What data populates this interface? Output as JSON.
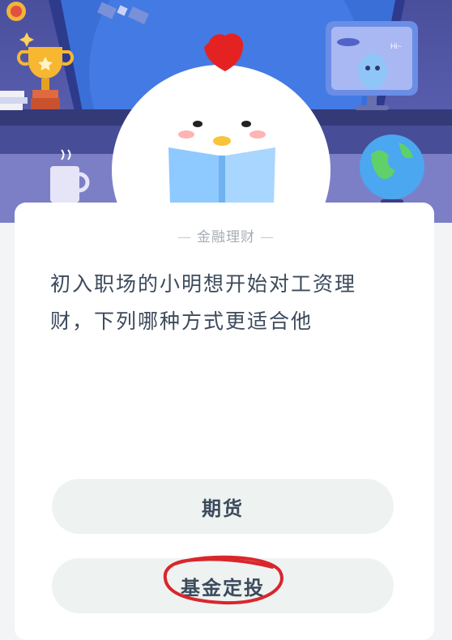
{
  "quiz": {
    "category": "金融理财",
    "category_dash": "—",
    "question": "初入职场的小明想开始对工资理财，下列哪种方式更适合他",
    "options": [
      {
        "label": "期货"
      },
      {
        "label": "基金定投"
      }
    ]
  },
  "illustration": {
    "monitor_greeting": "Hi~"
  },
  "colors": {
    "hero_background": "#5a5fb0",
    "card_background": "#ffffff",
    "option_background": "#eef3f2",
    "text_primary": "#3c4a5c",
    "annotation_red": "#d9262c"
  }
}
